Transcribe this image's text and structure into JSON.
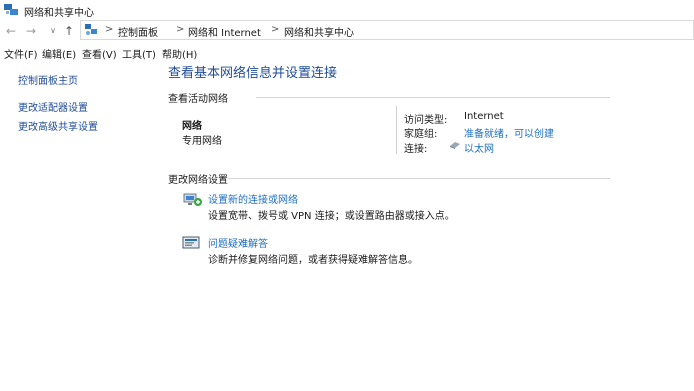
{
  "window": {
    "title": "网络和共享中心"
  },
  "address_bar": {
    "breadcrumbs": [
      "控制面板",
      "网络和 Internet",
      "网络和共享中心"
    ],
    "separator": ">"
  },
  "menu": [
    "文件(F)",
    "编辑(E)",
    "查看(V)",
    "工具(T)",
    "帮助(H)"
  ],
  "sidebar": {
    "items": [
      {
        "label": "控制面板主页"
      },
      {
        "label": "更改适配器设置"
      },
      {
        "label": "更改高级共享设置"
      }
    ]
  },
  "main": {
    "title": "查看基本网络信息并设置连接",
    "active_networks": {
      "label": "查看活动网络",
      "network_name": "网络",
      "network_type": "专用网络",
      "access_type_label": "访问类型:",
      "access_type_value": "Internet",
      "homegroup_label": "家庭组:",
      "homegroup_value": "准备就绪，可以创建",
      "connection_label": "连接:",
      "connection_value": "以太网"
    },
    "change_settings": {
      "label": "更改网络设置",
      "tasks": [
        {
          "title": "设置新的连接或网络",
          "desc": "设置宽带、拨号或 VPN 连接；或设置路由器或接入点。",
          "icon": "new-connection-icon"
        },
        {
          "title": "问题疑难解答",
          "desc": "诊断并修复网络问题，或者获得疑难解答信息。",
          "icon": "troubleshoot-icon"
        }
      ]
    }
  },
  "colors": {
    "link": "#1f6fc4",
    "heading": "#1f4b99"
  }
}
